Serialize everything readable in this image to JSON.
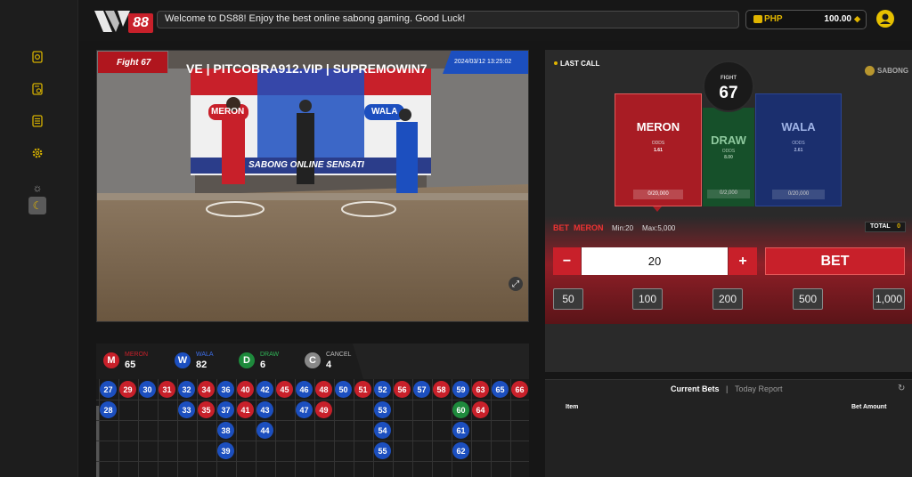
{
  "brand": {
    "logo_text": "88"
  },
  "topbar": {
    "marquee": "Welcome to DS88!   Enjoy the best online sabong gaming. Good Luck!",
    "currency": "PHP",
    "balance": "100.00"
  },
  "video": {
    "fight_label": "Fight 67",
    "datetime": "2024/03/12 13:25:02",
    "banner_text": "VE | PITCOBRA912.VIP | SUPREMOWIN7",
    "stage_left": "MERON",
    "stage_right": "WALA",
    "stage_mid": "SABONG  ONLINE SENSATI"
  },
  "stats": {
    "meron": {
      "letter": "M",
      "label": "MERON",
      "count": "65"
    },
    "wala": {
      "letter": "W",
      "label": "WALA",
      "count": "82"
    },
    "draw": {
      "letter": "D",
      "label": "DRAW",
      "count": "6"
    },
    "cancel": {
      "letter": "C",
      "label": "CANCEL",
      "count": "4"
    }
  },
  "board": {
    "columns": [
      [
        {
          "n": "27",
          "c": "b"
        },
        {
          "n": "28",
          "c": "b"
        }
      ],
      [
        {
          "n": "29",
          "c": "r"
        }
      ],
      [
        {
          "n": "30",
          "c": "b"
        }
      ],
      [
        {
          "n": "31",
          "c": "r"
        }
      ],
      [
        {
          "n": "32",
          "c": "b"
        },
        {
          "n": "33",
          "c": "b"
        }
      ],
      [
        {
          "n": "34",
          "c": "r"
        },
        {
          "n": "35",
          "c": "r"
        }
      ],
      [
        {
          "n": "36",
          "c": "b"
        },
        {
          "n": "37",
          "c": "b"
        },
        {
          "n": "38",
          "c": "b"
        },
        {
          "n": "39",
          "c": "b"
        }
      ],
      [
        {
          "n": "40",
          "c": "r"
        },
        {
          "n": "41",
          "c": "r"
        }
      ],
      [
        {
          "n": "42",
          "c": "b"
        },
        {
          "n": "43",
          "c": "b"
        },
        {
          "n": "44",
          "c": "b"
        }
      ],
      [
        {
          "n": "45",
          "c": "r"
        }
      ],
      [
        {
          "n": "46",
          "c": "b"
        },
        {
          "n": "47",
          "c": "b"
        }
      ],
      [
        {
          "n": "48",
          "c": "r"
        },
        {
          "n": "49",
          "c": "r"
        }
      ],
      [
        {
          "n": "50",
          "c": "b"
        }
      ],
      [
        {
          "n": "51",
          "c": "r"
        }
      ],
      [
        {
          "n": "52",
          "c": "b"
        },
        {
          "n": "53",
          "c": "b"
        },
        {
          "n": "54",
          "c": "b"
        },
        {
          "n": "55",
          "c": "b"
        }
      ],
      [
        {
          "n": "56",
          "c": "r"
        }
      ],
      [
        {
          "n": "57",
          "c": "b"
        }
      ],
      [
        {
          "n": "58",
          "c": "r"
        }
      ],
      [
        {
          "n": "59",
          "c": "b"
        },
        {
          "n": "60",
          "c": "g"
        },
        {
          "n": "61",
          "c": "b"
        },
        {
          "n": "62",
          "c": "b"
        }
      ],
      [
        {
          "n": "63",
          "c": "r"
        },
        {
          "n": "64",
          "c": "r"
        }
      ],
      [
        {
          "n": "65",
          "c": "b"
        }
      ],
      [
        {
          "n": "66",
          "c": "r"
        }
      ]
    ]
  },
  "betting": {
    "status": "LAST CALL",
    "game": "SABONG",
    "fight_caption": "FIGHT",
    "fight_no": "67",
    "meron": {
      "name": "MERON",
      "odds_label": "ODDS",
      "odds": "1.61",
      "pool": "0/20,000"
    },
    "draw": {
      "name": "DRAW",
      "odds_label": "ODDS",
      "odds": "8.00",
      "pool": "0/2,000"
    },
    "wala": {
      "name": "WALA",
      "odds_label": "ODDS",
      "odds": "2.61",
      "pool": "0/20,000"
    },
    "bet_prefix": "BET",
    "bet_side": "MERON",
    "min": "Min:20",
    "max": "Max:5,000",
    "total_label": "TOTAL",
    "total": "0",
    "minus": "−",
    "plus": "+",
    "amount": "20",
    "bet_label": "BET",
    "quick": [
      "50",
      "100",
      "200",
      "500",
      "1,000"
    ]
  },
  "bets_panel": {
    "tab_current": "Current Bets",
    "separator": "|",
    "tab_report": "Today Report",
    "col_item": "Item",
    "col_amount": "Bet Amount"
  },
  "colors": {
    "meron": "#c8202a",
    "wala": "#1c4fbf",
    "draw": "#1e8a3c",
    "accent": "#e0b400"
  }
}
